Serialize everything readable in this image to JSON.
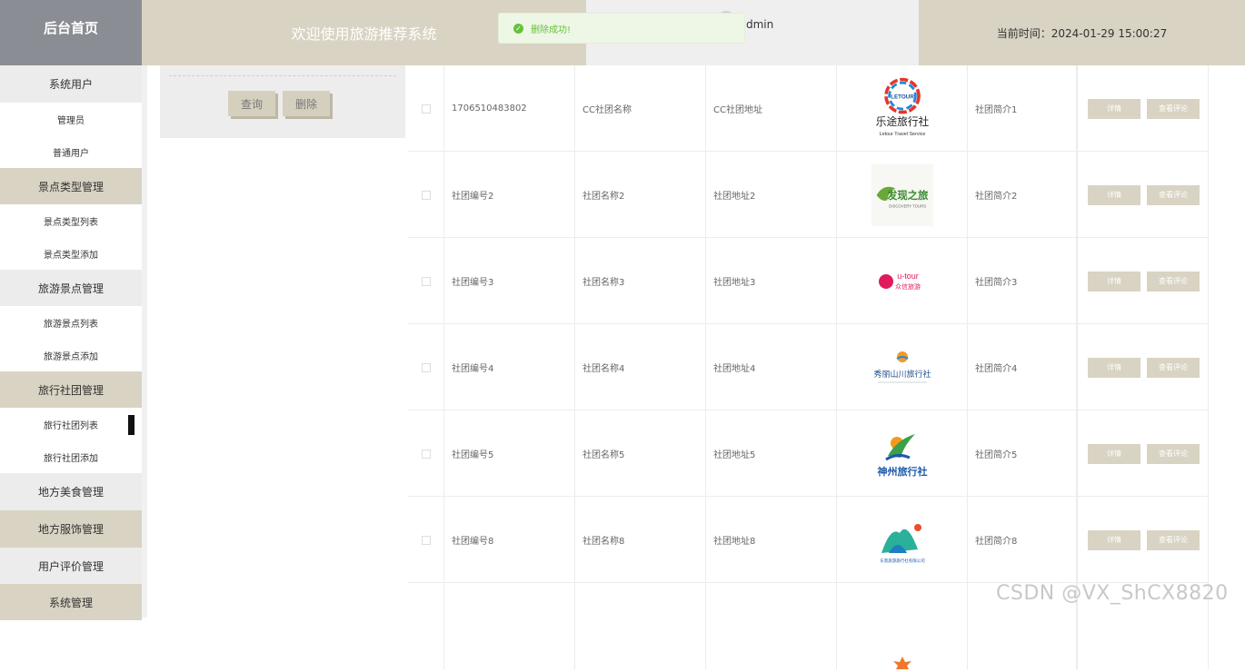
{
  "header": {
    "brand": "后台首页",
    "title": "欢迎使用旅游推荐系统",
    "username_fragment": "dmin",
    "time": "当前时间：2024-01-29 15:00:27"
  },
  "toast": {
    "message": "删除成功!",
    "color": "#67c23a"
  },
  "sidebar": {
    "items": [
      {
        "label": "系统用户",
        "level": "group"
      },
      {
        "label": "管理员",
        "level": "sub"
      },
      {
        "label": "普通用户",
        "level": "sub"
      },
      {
        "label": "景点类型管理",
        "level": "group"
      },
      {
        "label": "景点类型列表",
        "level": "sub"
      },
      {
        "label": "景点类型添加",
        "level": "sub"
      },
      {
        "label": "旅游景点管理",
        "level": "group"
      },
      {
        "label": "旅游景点列表",
        "level": "sub"
      },
      {
        "label": "旅游景点添加",
        "level": "sub"
      },
      {
        "label": "旅行社团管理",
        "level": "group"
      },
      {
        "label": "旅行社团列表",
        "level": "sub"
      },
      {
        "label": "旅行社团添加",
        "level": "sub"
      },
      {
        "label": "地方美食管理",
        "level": "group"
      },
      {
        "label": "地方服饰管理",
        "level": "group"
      },
      {
        "label": "用户评价管理",
        "level": "group"
      },
      {
        "label": "系统管理",
        "level": "group"
      }
    ]
  },
  "search": {
    "query_label": "查询",
    "delete_label": "删除"
  },
  "table": {
    "detail_label": "详情",
    "review_label": "查看评论",
    "rows": [
      {
        "id": "1706510483802",
        "name": "CC社团名称",
        "address": "CC社团地址",
        "desc": "社团简介1",
        "logo": "letour-logo",
        "logo_text": "乐途旅行社",
        "logo_sub": "Letour Travel Service",
        "logo_mark": "LETOUR"
      },
      {
        "id": "社团编号2",
        "name": "社团名称2",
        "address": "社团地址2",
        "desc": "社团简介2",
        "logo": "discovery-logo",
        "logo_text": "发现之旅",
        "logo_sub": "DISCOVERY TOURS"
      },
      {
        "id": "社团编号3",
        "name": "社团名称3",
        "address": "社团地址3",
        "desc": "社团简介3",
        "logo": "utour-logo",
        "logo_text": "u-tour",
        "logo_sub": "众信旅游"
      },
      {
        "id": "社团编号4",
        "name": "社团名称4",
        "address": "社团地址4",
        "desc": "社团简介4",
        "logo": "mountain-travel-logo",
        "logo_text": "秀丽山川旅行社"
      },
      {
        "id": "社团编号5",
        "name": "社团名称5",
        "address": "社团地址5",
        "desc": "社团简介5",
        "logo": "shenzhou-logo",
        "logo_text": "神州旅行社"
      },
      {
        "id": "社团编号8",
        "name": "社团名称8",
        "address": "社团地址8",
        "desc": "社团简介8",
        "logo": "hills-logo",
        "logo_text": "东景旅游旅行社有限公司"
      },
      {
        "id": "",
        "name": "",
        "address": "",
        "desc": "",
        "logo": "maple-logo"
      }
    ]
  },
  "watermark": "CSDN @VX_ShCX8820"
}
